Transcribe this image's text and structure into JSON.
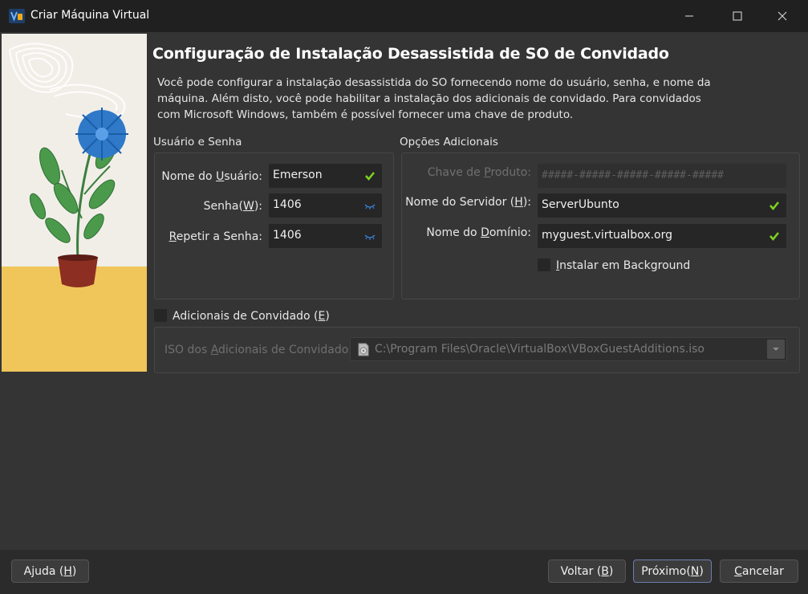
{
  "window": {
    "title": "Criar Máquina Virtual"
  },
  "page": {
    "title": "Configuração de Instalação Desassistida de SO de Convidado",
    "description": "Você pode configurar a instalação desassistida do SO fornecendo nome do usuário, senha, e nome da máquina. Além disto, você pode habilitar a instalação dos adicionais de convidado. Para convidados com Microsoft Windows, também é possível fornecer uma chave de produto."
  },
  "user_group": {
    "title": "Usuário e Senha",
    "username": {
      "label_pre": "Nome do ",
      "label_u": "U",
      "label_post": "suário:",
      "value": "Emerson"
    },
    "password": {
      "label_pre": "Senha(",
      "label_u": "W",
      "label_post": "):",
      "value": "1406"
    },
    "repeat_password": {
      "label_pre": "",
      "label_u": "R",
      "label_post": "epetir a Senha:",
      "value": "1406"
    }
  },
  "options_group": {
    "title": "Opções Adicionais",
    "product_key": {
      "label_pre": "Chave de ",
      "label_u": "P",
      "label_post": "roduto:",
      "placeholder": "#####-#####-#####-#####-#####"
    },
    "hostname": {
      "label_pre": "Nome do Servidor (",
      "label_u": "H",
      "label_post": "):",
      "value": "ServerUbunto"
    },
    "domain": {
      "label_pre": "Nome do ",
      "label_u": "D",
      "label_post": "omínio:",
      "value": "myguest.virtualbox.org"
    },
    "background": {
      "label_pre": "",
      "label_u": "I",
      "label_post": "nstalar em Background",
      "checked": false
    }
  },
  "guest_additions": {
    "checkbox_label_pre": "Adicionais de Convidado (",
    "checkbox_label_u": "E",
    "checkbox_label_post": ")",
    "checked": false,
    "iso_label_pre": "ISO dos ",
    "iso_label_u": "A",
    "iso_label_post": "dicionais de Convidado:",
    "iso_path": "C:\\Program Files\\Oracle\\VirtualBox\\VBoxGuestAdditions.iso"
  },
  "buttons": {
    "help": {
      "pre": "Ajuda (",
      "u": "H",
      "post": ")"
    },
    "back": {
      "pre": "Voltar (",
      "u": "B",
      "post": ")"
    },
    "next": {
      "pre": "Próximo(",
      "u": "N",
      "post": ")"
    },
    "cancel": {
      "pre": "",
      "u": "C",
      "post": "ancelar"
    }
  },
  "colors": {
    "valid_check": "#7ed321",
    "accent": "#6c7fb0",
    "password_icon": "#3a7fd5"
  },
  "icons": [
    "virtualbox-app-icon",
    "minimize-icon",
    "maximize-icon",
    "close-icon",
    "checkmark-icon",
    "password-strength-icon",
    "disk-icon",
    "chevron-down-icon"
  ]
}
